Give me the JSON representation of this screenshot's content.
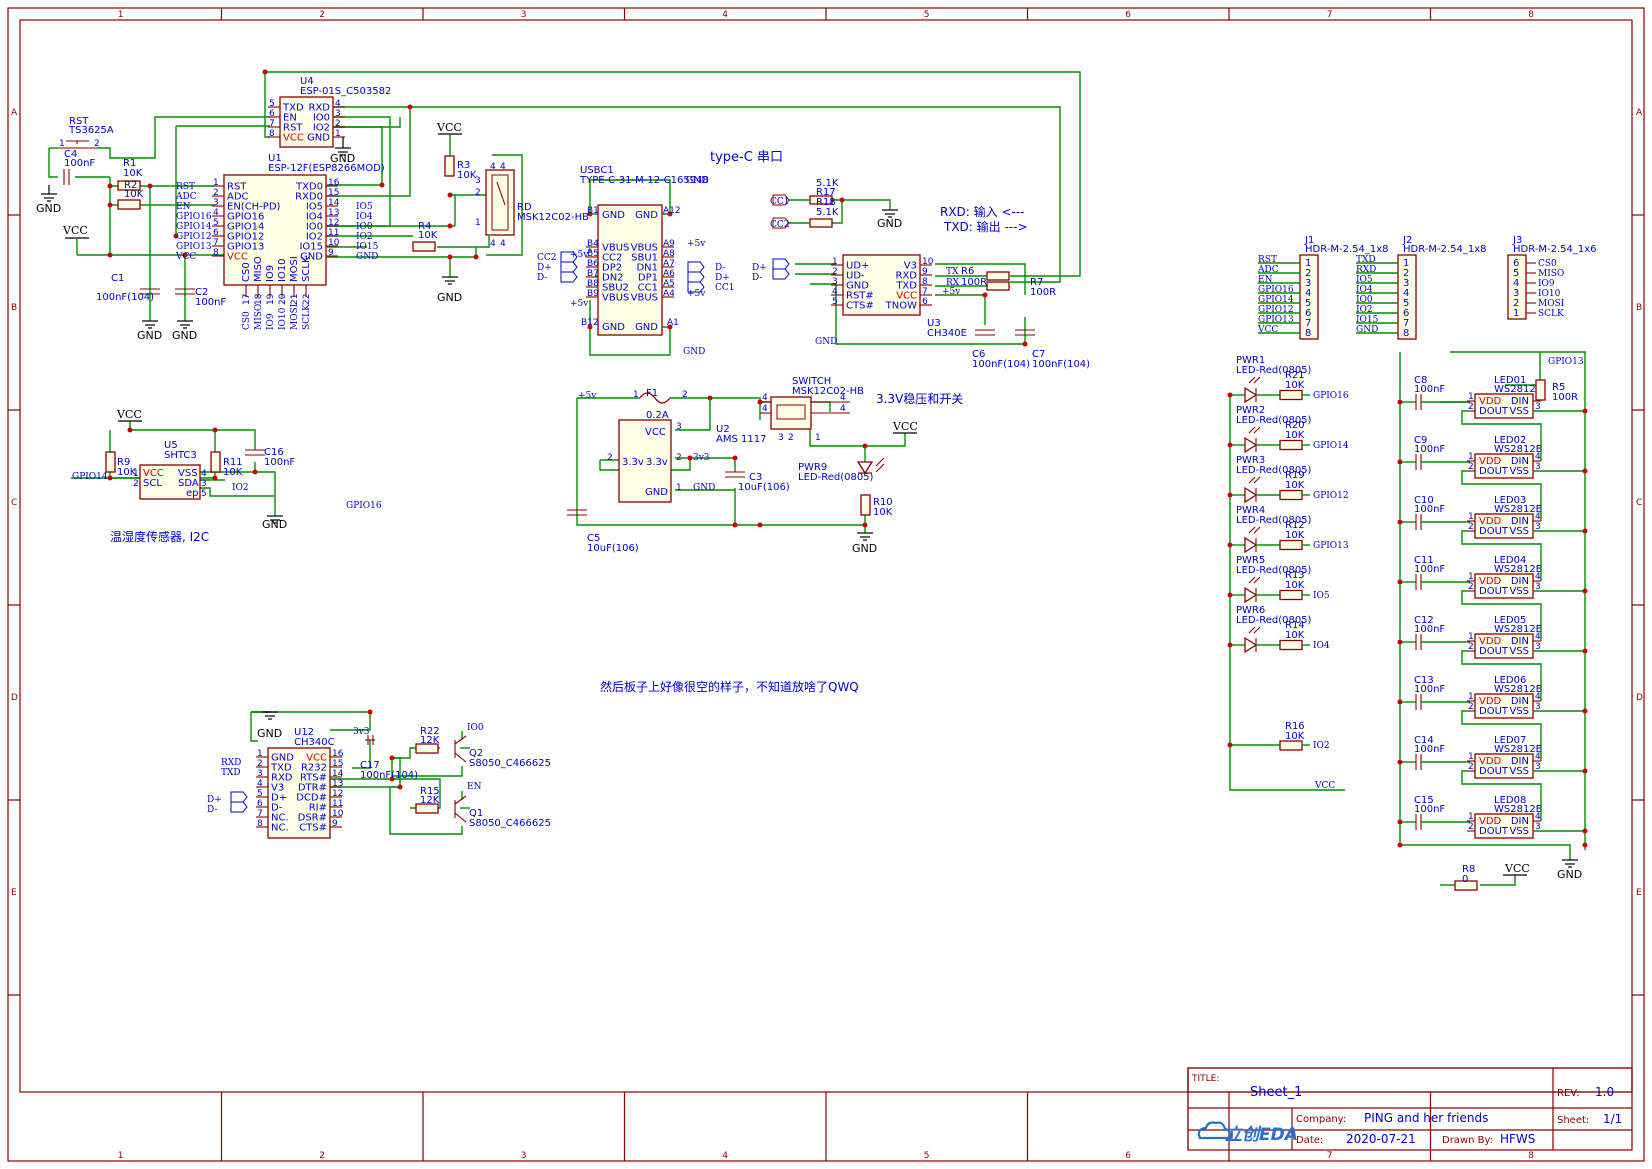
{
  "frame": {
    "columns": [
      "1",
      "2",
      "3",
      "4",
      "5",
      "6",
      "7",
      "8"
    ],
    "rows": [
      "A",
      "B",
      "C",
      "D",
      "E"
    ]
  },
  "title_block": {
    "title_label": "TITLE:",
    "title": "Sheet_1",
    "rev_label": "REV:",
    "rev": "1.0",
    "company_label": "Company:",
    "company": "PING and her friends",
    "sheet_label": "Sheet:",
    "sheet": "1/1",
    "date_label": "Date:",
    "date": "2020-07-21",
    "drawn_label": "Drawn By:",
    "drawn": "HFWS",
    "logo": "立创EDA"
  },
  "notes": {
    "typec": "type-C 串口",
    "rxd": "RXD: 输入 <---",
    "txd": "TXD: 输出 --->",
    "reg": "3.3V稳压和开关",
    "sensor": "温湿度传感器, I2C",
    "empty": "然后板子上好像很空的样子，不知道放啥了QWQ"
  },
  "rst": {
    "ref": "RST",
    "part": "TS3625A"
  },
  "c4": {
    "ref": "C4",
    "val": "100nF"
  },
  "r1": {
    "ref": "R1",
    "val": "10K"
  },
  "r2": {
    "ref": "R2",
    "val": "10K"
  },
  "c1": {
    "ref": "C1",
    "val": "100nF(104)"
  },
  "c2": {
    "ref": "C2",
    "val": "100nF"
  },
  "u4": {
    "ref": "U4",
    "part": "ESP-01S_C503582",
    "left": [
      "TXD",
      "EN",
      "RST",
      "VCC"
    ],
    "right": [
      "RXD",
      "IO0",
      "IO2",
      "GND"
    ],
    "lnum": [
      "5",
      "6",
      "7",
      "8"
    ],
    "rnum": [
      "4",
      "3",
      "2",
      "1"
    ]
  },
  "u1": {
    "ref": "U1",
    "part": "ESP-12F(ESP8266MOD)",
    "left": [
      "RST",
      "ADC",
      "EN(CH-PD)",
      "GPIO16",
      "GPIO14",
      "GPIO12",
      "GPIO13",
      "VCC"
    ],
    "lnum": [
      "1",
      "2",
      "3",
      "4",
      "5",
      "6",
      "7",
      "8"
    ],
    "right": [
      "TXD0",
      "RXD0",
      "IO5",
      "IO4",
      "IO0",
      "IO2",
      "IO15",
      "GND"
    ],
    "rnum": [
      "16",
      "15",
      "14",
      "13",
      "12",
      "11",
      "10",
      "9"
    ],
    "bottom": [
      "CS0",
      "MISO",
      "IO9",
      "IO10",
      "MOSI",
      "SCLK"
    ],
    "bnum": [
      "17",
      "18",
      "19",
      "20",
      "21",
      "22"
    ],
    "nets_left": [
      "RST",
      "ADC",
      "EN",
      "GPIO16",
      "GPIO14",
      "GPIO12",
      "GPIO13",
      "VCC"
    ],
    "nets_right": [
      "IO5",
      "IO4",
      "IO0",
      "IO2",
      "IO15",
      "GND"
    ]
  },
  "r3": {
    "ref": "R3",
    "val": "10K"
  },
  "r4": {
    "ref": "R4",
    "val": "10K"
  },
  "rd": {
    "ref": "RD",
    "part": "MSK12C02-HB"
  },
  "usbc1": {
    "ref": "USBC1",
    "part": "TYPE-C-31-M-12-C165948",
    "left": [
      "VBUS",
      "CC2",
      "DP2",
      "DN2",
      "SBU2",
      "VBUS"
    ],
    "lnum": [
      "B4",
      "B5",
      "B6",
      "B7",
      "B8",
      "B9"
    ],
    "right": [
      "VBUS",
      "SBU1",
      "DN1",
      "DP1",
      "CC1",
      "VBUS"
    ],
    "rnum": [
      "A9",
      "A8",
      "A7",
      "A6",
      "A5",
      "A4"
    ],
    "pin_top": [
      "B1",
      "A12"
    ],
    "pin_bot": [
      "B12",
      "A1"
    ],
    "gnd": "GND",
    "nets_left": [
      "CC2",
      "D+",
      "D-"
    ],
    "nets_right": [
      "D-",
      "D+",
      "CC1"
    ]
  },
  "r17": {
    "ref": "R17",
    "val": "5.1K"
  },
  "r18": {
    "ref": "R18",
    "val": "5.1K"
  },
  "u3": {
    "ref": "U3",
    "part": "CH340E",
    "left": [
      "UD+",
      "UD-",
      "GND",
      "RST#",
      "CTS#"
    ],
    "lnum": [
      "1",
      "2",
      "3",
      "4",
      "5"
    ],
    "right": [
      "V3",
      "RXD",
      "TXD",
      "VCC",
      "TNOW"
    ],
    "rnum": [
      "10",
      "9",
      "8",
      "7",
      "6"
    ]
  },
  "r6": {
    "ref": "R6",
    "val": "100R"
  },
  "r7": {
    "ref": "R7",
    "val": "100R"
  },
  "c6": {
    "ref": "C6",
    "val": "100nF(104)"
  },
  "c7": {
    "ref": "C7",
    "val": "100nF(104)"
  },
  "f1": {
    "ref": "F1",
    "val": "0.2A"
  },
  "u2": {
    "ref": "U2",
    "part": "AMS 1117",
    "pins": [
      "VCC",
      "3.3v",
      "3.3v",
      "GND"
    ]
  },
  "switch": {
    "ref": "SWITCH",
    "part": "MSK12C02-HB"
  },
  "c3": {
    "ref": "C3",
    "val": "10uF(106)"
  },
  "c5": {
    "ref": "C5",
    "val": "10uF(106)"
  },
  "pwr9": {
    "ref": "PWR9",
    "part": "LED-Red(0805)"
  },
  "r10": {
    "ref": "R10",
    "val": "10K"
  },
  "u5": {
    "ref": "U5",
    "part": "SHTC3",
    "left": [
      "VCC",
      "SCL"
    ],
    "right": [
      "VSS",
      "SDA",
      "ep"
    ]
  },
  "r9": {
    "ref": "R9",
    "val": "10K"
  },
  "r11": {
    "ref": "R11",
    "val": "10K"
  },
  "c16": {
    "ref": "C16",
    "val": "100nF"
  },
  "u12": {
    "ref": "U12",
    "part": "CH340C",
    "left": [
      "GND",
      "TXD",
      "RXD",
      "V3",
      "D+",
      "D-",
      "NC.",
      "NC."
    ],
    "lnum": [
      "1",
      "2",
      "3",
      "4",
      "5",
      "6",
      "7",
      "8"
    ],
    "right": [
      "VCC",
      "R232",
      "RTS#",
      "DTR#",
      "DCD#",
      "RI#",
      "DSR#",
      "CTS#"
    ],
    "rnum": [
      "16",
      "15",
      "14",
      "13",
      "12",
      "11",
      "10",
      "9"
    ]
  },
  "c17": {
    "ref": "C17",
    "val": "100nF(104)"
  },
  "r22": {
    "ref": "R22",
    "val": "12K"
  },
  "r15": {
    "ref": "R15",
    "val": "12K"
  },
  "q2": {
    "ref": "Q2",
    "part": "S8050_C466625"
  },
  "q1": {
    "ref": "Q1",
    "part": "S8050_C466625"
  },
  "j1": {
    "ref": "J1",
    "part": "HDR-M-2.54_1x8",
    "nets": [
      "RST",
      "ADC",
      "EN",
      "GPIO16",
      "GPIO14",
      "GPIO12",
      "GPIO13",
      "VCC"
    ],
    "pins": [
      "1",
      "2",
      "3",
      "4",
      "5",
      "6",
      "7",
      "8"
    ]
  },
  "j2": {
    "ref": "J2",
    "part": "HDR-M-2.54_1x8",
    "nets": [
      "TXD",
      "RXD",
      "IO5",
      "IO4",
      "IO0",
      "IO2",
      "IO15",
      "GND"
    ],
    "pins": [
      "1",
      "2",
      "3",
      "4",
      "5",
      "6",
      "7",
      "8"
    ]
  },
  "j3": {
    "ref": "J3",
    "part": "HDR-M-2.54_1x6",
    "nets": [
      "CS0",
      "MISO",
      "IO9",
      "IO10",
      "MOSI",
      "SCLK"
    ],
    "pins": [
      "6",
      "5",
      "4",
      "3",
      "2",
      "1"
    ]
  },
  "pwr_leds": [
    {
      "ref": "PWR1",
      "part": "LED-Red(0805)",
      "res": "R21",
      "val": "10K",
      "net": "GPIO16"
    },
    {
      "ref": "PWR2",
      "part": "LED-Red(0805)",
      "res": "R20",
      "val": "10K",
      "net": "GPIO14"
    },
    {
      "ref": "PWR3",
      "part": "LED-Red(0805)",
      "res": "R19",
      "val": "10K",
      "net": "GPIO12"
    },
    {
      "ref": "PWR4",
      "part": "LED-Red(0805)",
      "res": "R12",
      "val": "10K",
      "net": "GPIO13"
    },
    {
      "ref": "PWR5",
      "part": "LED-Red(0805)",
      "res": "R13",
      "val": "10K",
      "net": "IO5"
    },
    {
      "ref": "PWR6",
      "part": "LED-Red(0805)",
      "res": "R14",
      "val": "10K",
      "net": "IO4"
    }
  ],
  "r16": {
    "ref": "R16",
    "val": "10K",
    "net": "IO2"
  },
  "led_chain": [
    {
      "ref": "LED01",
      "cap": "C8"
    },
    {
      "ref": "LED02",
      "cap": "C9"
    },
    {
      "ref": "LED03",
      "cap": "C10"
    },
    {
      "ref": "LED04",
      "cap": "C11"
    },
    {
      "ref": "LED05",
      "cap": "C12"
    },
    {
      "ref": "LED06",
      "cap": "C13"
    },
    {
      "ref": "LED07",
      "cap": "C14"
    },
    {
      "ref": "LED08",
      "cap": "C15"
    }
  ],
  "ws": {
    "part": "WS2812E",
    "cap_val": "100nF",
    "pins_left": [
      "VDD",
      "DOUT"
    ],
    "pins_right": [
      "DIN",
      "VSS"
    ]
  },
  "r5": {
    "ref": "R5",
    "val": "100R",
    "net": "GPIO13"
  },
  "r8": {
    "ref": "R8",
    "val": "0"
  },
  "labels": {
    "vcc": "VCC",
    "gnd": "GND",
    "p5v": "+5v",
    "p3v3": "3v3",
    "gpio14": "GPIO14",
    "gpio16": "GPIO16",
    "io2": "IO2",
    "io0": "IO0",
    "en": "EN",
    "rxd": "RXD",
    "txd": "TXD",
    "dp": "D+",
    "dm": "D-",
    "cc1": "CC1",
    "cc2": "CC2",
    "tx": "TX",
    "rx": "RX"
  },
  "colors": {
    "frame": "#880000",
    "wire": "#008800",
    "body": "#880000",
    "text": "#0000cc",
    "power": "#cc0000",
    "junction": "#cc0000"
  }
}
